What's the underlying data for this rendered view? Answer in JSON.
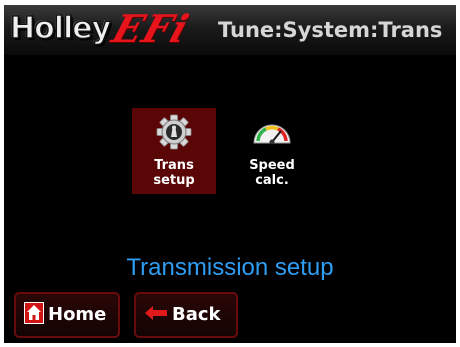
{
  "header": {
    "brand_left": "Holley",
    "brand_right": "EFi",
    "title": "Tune:System:Trans"
  },
  "tiles": [
    {
      "label_line1": "Trans",
      "label_line2": "setup",
      "icon": "gear-cog-icon",
      "selected": true
    },
    {
      "label_line1": "Speed",
      "label_line2": "calc.",
      "icon": "speedometer-gauge-icon",
      "selected": false
    }
  ],
  "description": "Transmission setup",
  "buttons": {
    "home_label": "Home",
    "back_label": "Back"
  },
  "colors": {
    "accent_red": "#e8141c",
    "selected_tile": "#5a0606",
    "description_blue": "#2f9df2",
    "button_border": "#6a0b0b"
  }
}
